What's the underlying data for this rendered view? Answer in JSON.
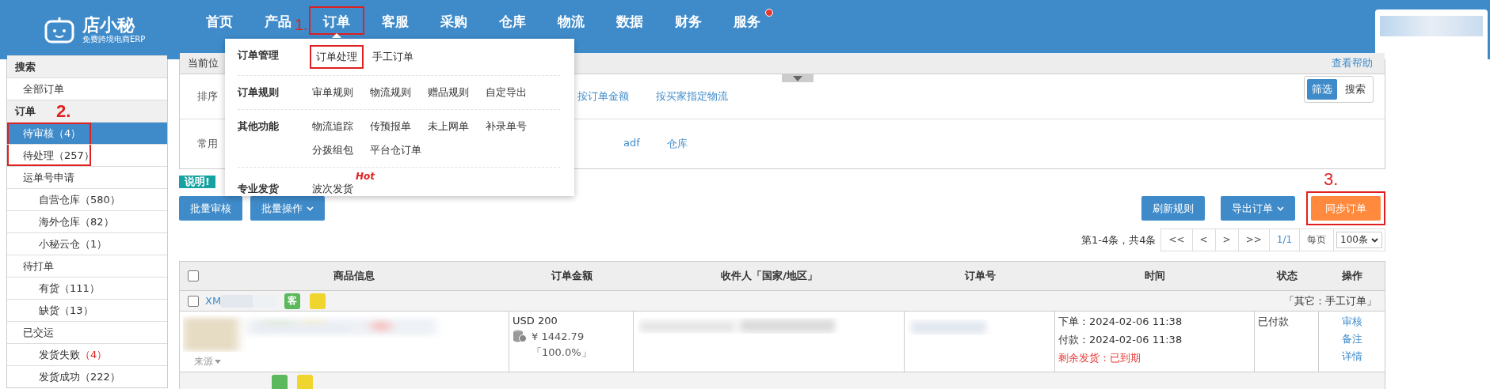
{
  "header": {
    "logo": {
      "name": "店小秘",
      "tagline": "免费跨境电商ERP"
    },
    "nav": [
      {
        "label": "首页",
        "selected": false,
        "dot": false,
        "highlighted": false
      },
      {
        "label": "产品",
        "selected": false,
        "dot": false,
        "highlighted": false
      },
      {
        "label": "订单",
        "selected": true,
        "dot": false,
        "highlighted": true,
        "annotation": "1."
      },
      {
        "label": "客服",
        "selected": false,
        "dot": false,
        "highlighted": false
      },
      {
        "label": "采购",
        "selected": false,
        "dot": false,
        "highlighted": false
      },
      {
        "label": "仓库",
        "selected": false,
        "dot": false,
        "highlighted": false
      },
      {
        "label": "物流",
        "selected": false,
        "dot": false,
        "highlighted": false
      },
      {
        "label": "数据",
        "selected": false,
        "dot": false,
        "highlighted": false
      },
      {
        "label": "财务",
        "selected": false,
        "dot": false,
        "highlighted": false
      },
      {
        "label": "服务",
        "selected": false,
        "dot": true,
        "highlighted": false
      }
    ]
  },
  "sidebar": {
    "items": [
      {
        "kind": "header",
        "label": "搜索",
        "selected": false,
        "highlighted": false
      },
      {
        "kind": "item",
        "label": "全部订单",
        "selected": false,
        "highlighted": false
      },
      {
        "kind": "header",
        "label": "订单",
        "selected": false,
        "highlighted": false,
        "annotation": "2."
      },
      {
        "kind": "item",
        "label": "待审核",
        "count": "（4）",
        "alert": false,
        "selected": true,
        "highlighted": true
      },
      {
        "kind": "item",
        "label": "待处理",
        "count": "（257）",
        "alert": false,
        "selected": false,
        "highlighted": true
      },
      {
        "kind": "item",
        "label": "运单号申请",
        "selected": false,
        "highlighted": false
      },
      {
        "kind": "sub",
        "label": "自营仓库",
        "count": "（580）",
        "alert": false,
        "selected": false,
        "highlighted": false
      },
      {
        "kind": "sub",
        "label": "海外仓库",
        "count": "（82）",
        "alert": false,
        "selected": false,
        "highlighted": false
      },
      {
        "kind": "sub",
        "label": "小秘云仓",
        "count": "（1）",
        "alert": false,
        "selected": false,
        "highlighted": false
      },
      {
        "kind": "item",
        "label": "待打单",
        "selected": false,
        "highlighted": false
      },
      {
        "kind": "sub",
        "label": "有货",
        "count": "（111）",
        "alert": false,
        "selected": false,
        "highlighted": false
      },
      {
        "kind": "sub",
        "label": "缺货",
        "count": "（13）",
        "alert": false,
        "selected": false,
        "highlighted": false
      },
      {
        "kind": "item",
        "label": "已交运",
        "selected": false,
        "highlighted": false
      },
      {
        "kind": "sub",
        "label": "发货失败",
        "count": "（4）",
        "alert": true,
        "selected": false,
        "highlighted": false
      },
      {
        "kind": "sub",
        "label": "发货成功",
        "count": "（222）",
        "alert": false,
        "selected": false,
        "highlighted": false
      }
    ]
  },
  "filter": {
    "location": "当前位",
    "help": "查看帮助",
    "rows": [
      {
        "label": "排序",
        "options": [
          "按订单金额",
          "按买家指定物流"
        ]
      },
      {
        "label": "常用",
        "options": [
          "adf",
          "仓库"
        ]
      }
    ],
    "toggle": [
      {
        "label": "筛选",
        "selected": true
      },
      {
        "label": "搜索",
        "selected": false
      }
    ]
  },
  "menu": {
    "groups": [
      {
        "label": "订单管理",
        "items": [
          {
            "label": "订单处理",
            "highlighted": true
          },
          {
            "label": "手工订单",
            "highlighted": false
          }
        ]
      },
      {
        "label": "订单规则",
        "items": [
          {
            "label": "审单规则",
            "highlighted": false
          },
          {
            "label": "物流规则",
            "highlighted": false
          },
          {
            "label": "赠品规则",
            "highlighted": false
          },
          {
            "label": "自定导出",
            "highlighted": false
          }
        ]
      },
      {
        "label": "其他功能",
        "items": [
          {
            "label": "物流追踪",
            "highlighted": false
          },
          {
            "label": "传预报单",
            "highlighted": false
          },
          {
            "label": "未上网单",
            "highlighted": false
          },
          {
            "label": "补录单号",
            "highlighted": false
          },
          {
            "label": "分拨组包",
            "highlighted": false
          },
          {
            "label": "平台仓订单",
            "highlighted": false
          }
        ]
      },
      {
        "label": "专业发货",
        "items": [
          {
            "label": "波次发货",
            "highlighted": false,
            "badge": "Hot"
          }
        ]
      }
    ]
  },
  "notice": "说明!",
  "actions_left": [
    {
      "label": "批量审核",
      "dropdown": false
    },
    {
      "label": "批量操作",
      "dropdown": true
    }
  ],
  "actions_right": [
    {
      "label": "刷新规则",
      "kind": "primary",
      "dropdown": false,
      "highlighted": false
    },
    {
      "label": "导出订单",
      "kind": "primary",
      "dropdown": true,
      "highlighted": false
    },
    {
      "label": "同步订单",
      "kind": "accent",
      "dropdown": false,
      "highlighted": true,
      "annotation": "3."
    }
  ],
  "pagination": {
    "summary": "第1-4条，共4条",
    "buttons": [
      "<<",
      "<",
      ">",
      ">>"
    ],
    "page": "1/1",
    "per_page_label": "每页",
    "per_page": "100条"
  },
  "table": {
    "select_all": {
      "checked": false
    },
    "columns": [
      "商品信息",
      "订单金额",
      "收件人「国家/地区」",
      "订单号",
      "时间",
      "状态",
      "操作"
    ],
    "orders": [
      {
        "checked": false,
        "id_prefix": "XM",
        "tags": [
          {
            "label": "客",
            "color": "#5cb85c"
          },
          {
            "color": "#efd52e"
          }
        ],
        "source_note": "「其它：手工订单」",
        "source": "来源",
        "amount": "USD 200",
        "cny": "¥  1442.79",
        "ratio": "「100.0%」",
        "times": [
          "下单：2024-02-06 11:38",
          "付款：2024-02-06 11:38"
        ],
        "deadline": "剩余发货：已到期",
        "status": "已付款",
        "ops": [
          "审核",
          "备注",
          "详情"
        ]
      }
    ],
    "next_tags": [
      {
        "color": "#5cb85c"
      },
      {
        "color": "#efd52e"
      }
    ]
  }
}
